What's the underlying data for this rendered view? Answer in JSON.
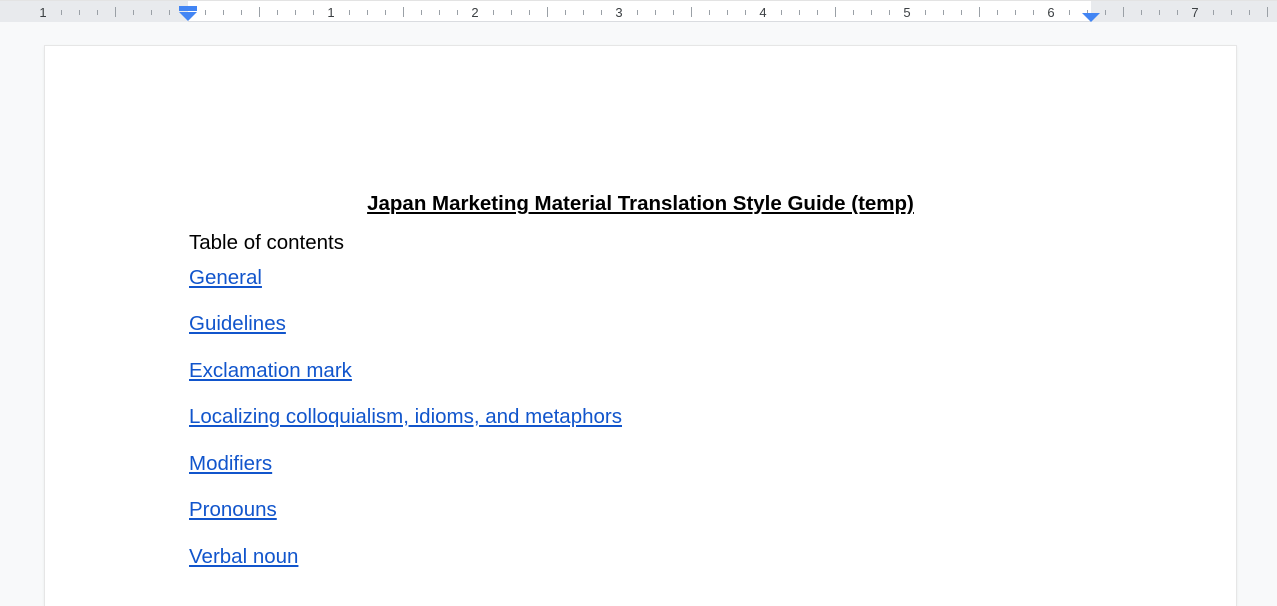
{
  "ruler": {
    "labels": [
      "1",
      "1",
      "2",
      "3",
      "4",
      "5",
      "6",
      "7"
    ]
  },
  "document": {
    "title": "Japan Marketing Material Translation Style Guide (temp)",
    "toc_heading": "Table of contents",
    "toc": [
      "General",
      "Guidelines",
      "Exclamation mark",
      "Localizing colloquialism, idioms, and metaphors",
      "Modifiers",
      "Pronouns",
      "Verbal noun"
    ]
  },
  "colors": {
    "link": "#1155cc",
    "marker": "#4285f4"
  }
}
